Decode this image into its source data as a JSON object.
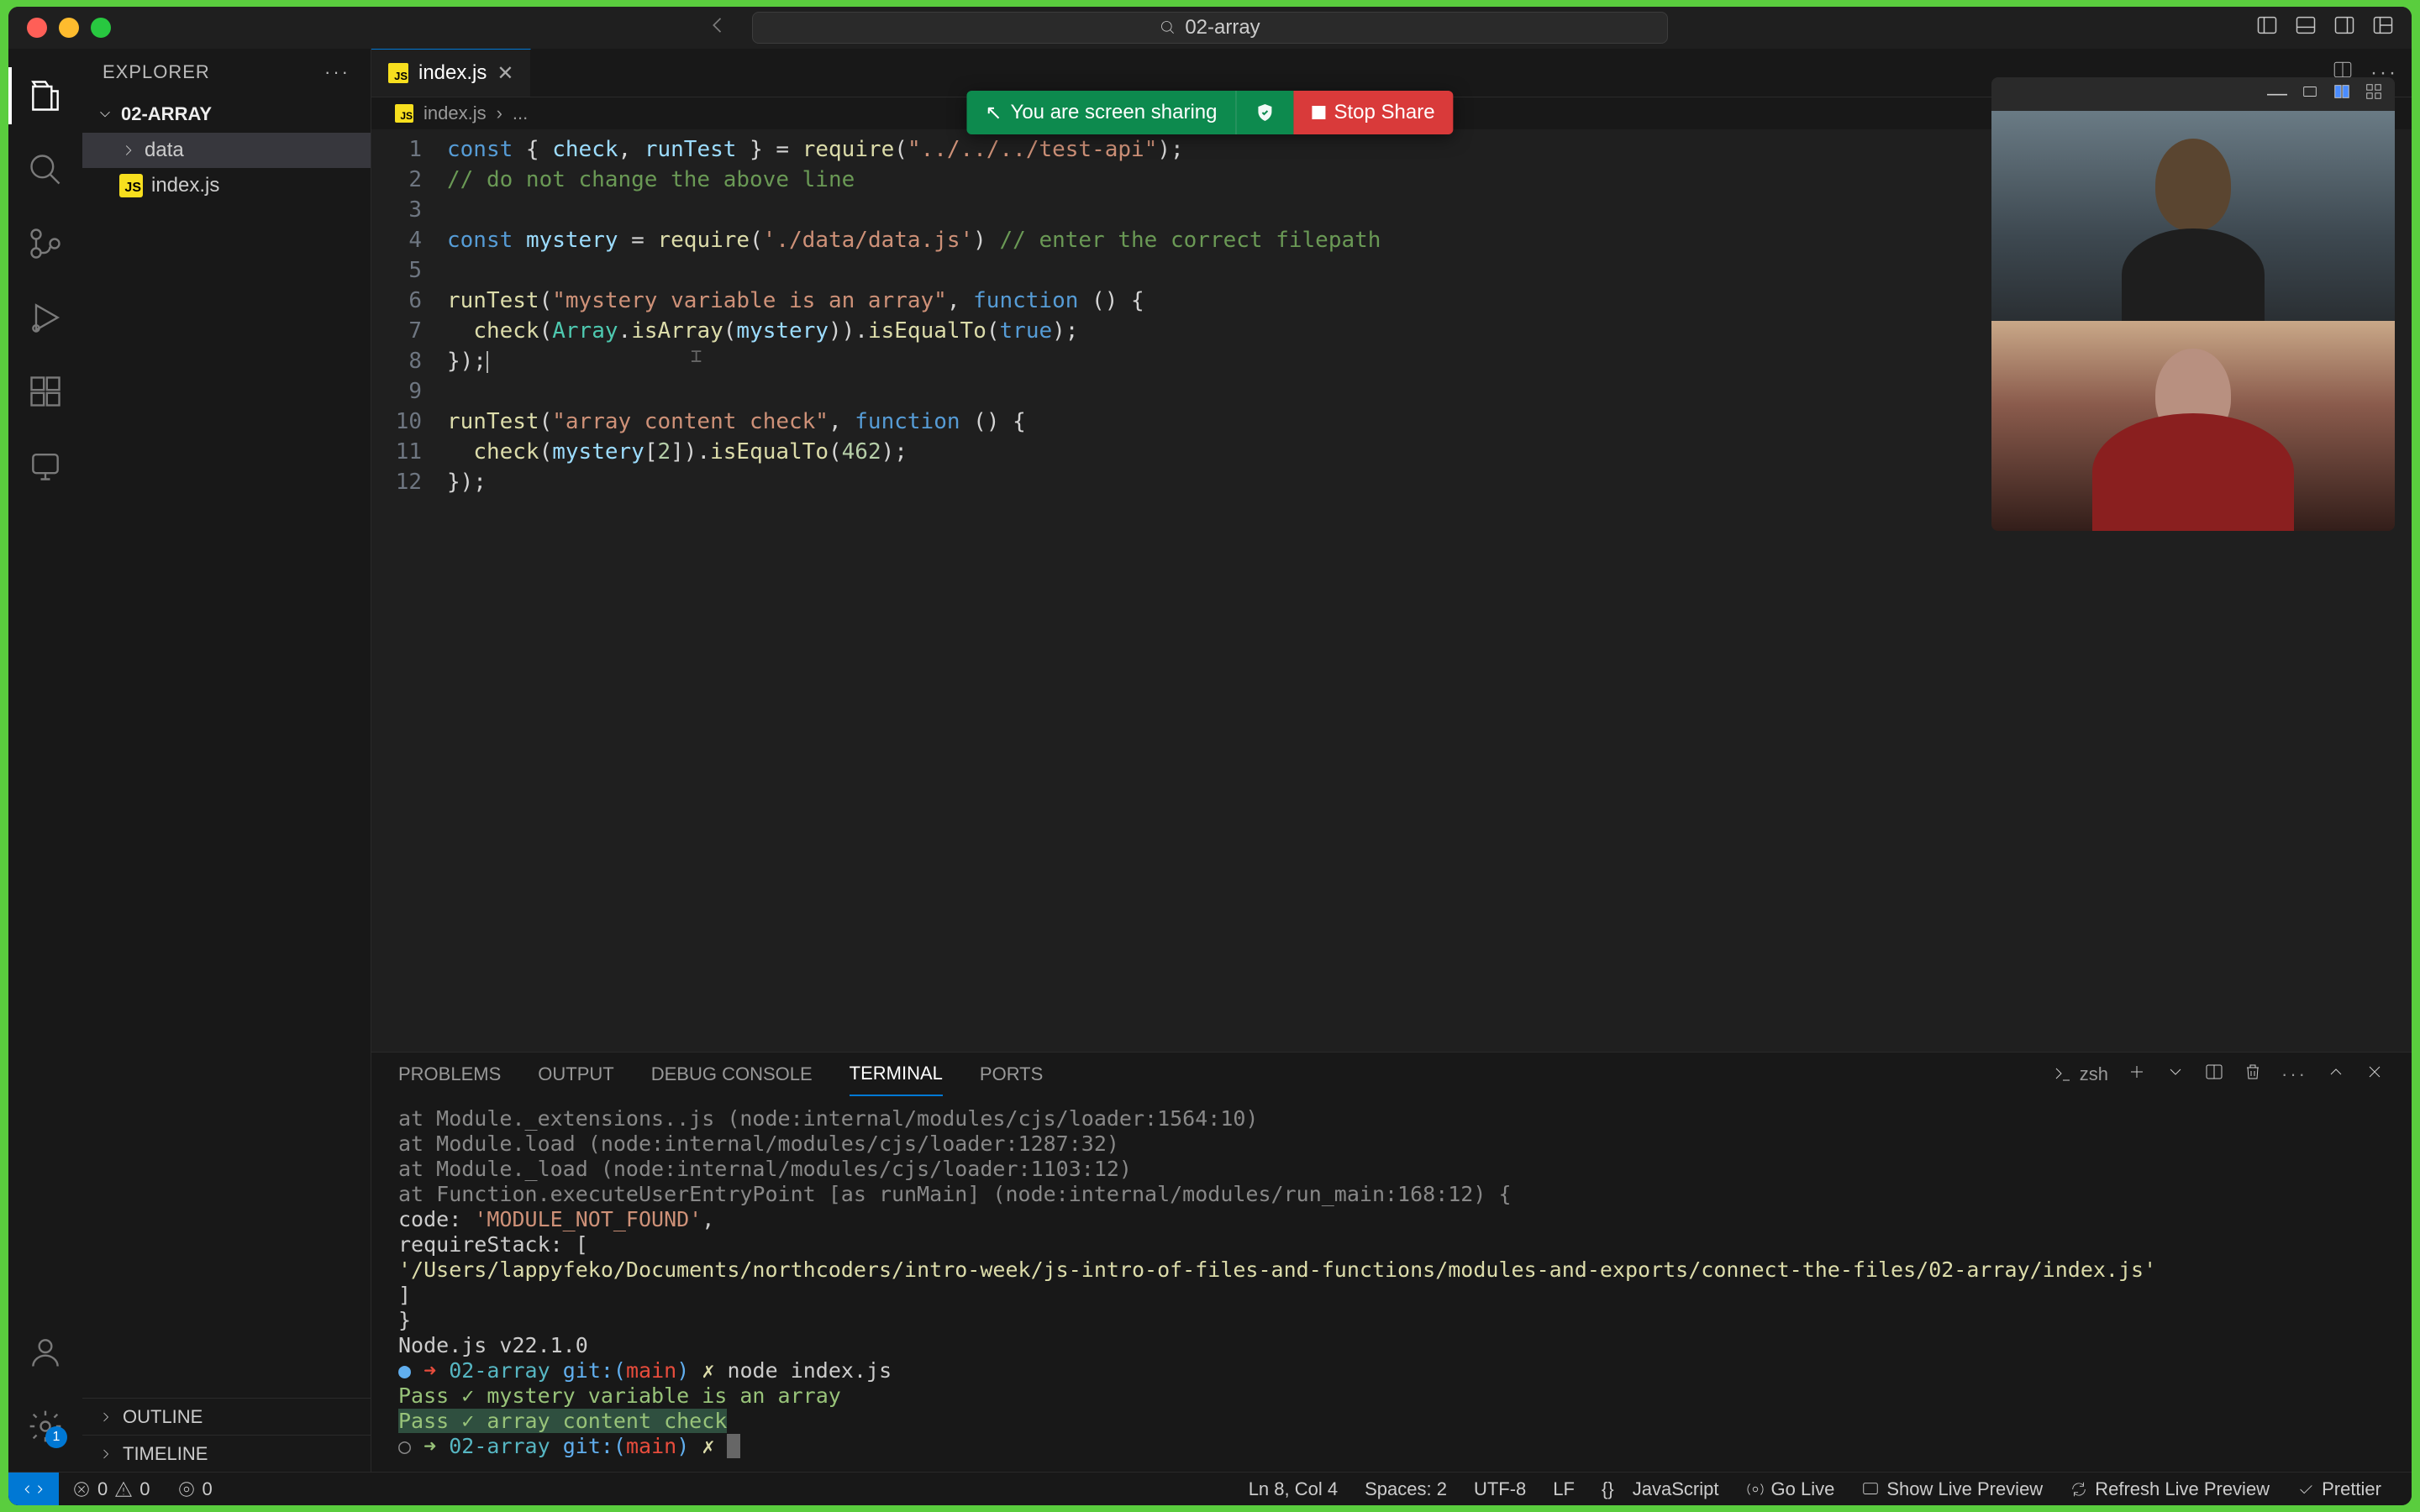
{
  "titlebar": {
    "search": "02-array"
  },
  "explorer": {
    "title": "EXPLORER",
    "root": "02-ARRAY",
    "items": [
      {
        "label": "data",
        "type": "folder"
      },
      {
        "label": "index.js",
        "type": "file"
      }
    ],
    "outline": "OUTLINE",
    "timeline": "TIMELINE"
  },
  "tabs": {
    "active": "index.js"
  },
  "breadcrumbs": {
    "file": "index.js",
    "sep": "›",
    "ellipsis": "..."
  },
  "share": {
    "text": "You are screen sharing",
    "stop": "Stop Share"
  },
  "code": {
    "lines": [
      "const { check, runTest } = require(\"../../../test-api\");",
      "// do not change the above line",
      "",
      "const mystery = require('./data/data.js') // enter the correct filepath",
      "",
      "runTest(\"mystery variable is an array\", function () {",
      "  check(Array.isArray(mystery)).isEqualTo(true);",
      "});",
      "",
      "runTest(\"array content check\", function () {",
      "  check(mystery[2]).isEqualTo(462);",
      "});"
    ]
  },
  "panel": {
    "tabs": [
      "PROBLEMS",
      "OUTPUT",
      "DEBUG CONSOLE",
      "TERMINAL",
      "PORTS"
    ],
    "shell": "zsh"
  },
  "terminal": {
    "l1": "    at Module._extensions..js (node:internal/modules/cjs/loader:1564:10)",
    "l2": "    at Module.load (node:internal/modules/cjs/loader:1287:32)",
    "l3": "    at Module._load (node:internal/modules/cjs/loader:1103:12)",
    "l4": "    at Function.executeUserEntryPoint [as runMain] (node:internal/modules/run_main:168:12) {",
    "l5a": "  code: ",
    "l5b": "'MODULE_NOT_FOUND'",
    "l5c": ",",
    "l6": "  requireStack: [",
    "l7a": "    ",
    "l7b": "'/Users/lappyfeko/Documents/northcoders/intro-week/js-intro-of-files-and-functions/modules-and-exports/connect-the-files/02-array/index.js'",
    "l8": "  ]",
    "l9": "}",
    "l10": "",
    "nodev": "Node.js v22.1.0",
    "p1_dir": "02-array",
    "p1_git": "git:(",
    "p1_branch": "main",
    "p1_gitc": ")",
    "p1_x": "✗",
    "p1_cmd": "node index.js",
    "pass1": "   Pass ✓ mystery variable is an array",
    "pass2": "   Pass ✓ array content check",
    "arrow": "➜ "
  },
  "status": {
    "errors": "0",
    "warnings": "0",
    "ports": "0",
    "lncol": "Ln 8, Col 4",
    "spaces": "Spaces: 2",
    "enc": "UTF-8",
    "eol": "LF",
    "lang_icon": "{}",
    "lang": "JavaScript",
    "golive": "Go Live",
    "livep": "Show Live Preview",
    "refresh": "Refresh Live Preview",
    "prettier": "Prettier"
  },
  "accounts_badge": "1"
}
